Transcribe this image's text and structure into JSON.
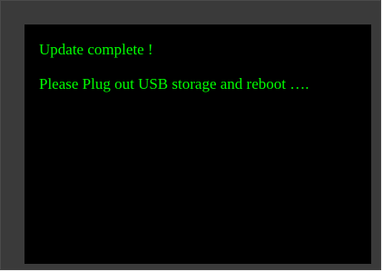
{
  "theme": {
    "text_color": "#00ff00",
    "screen_background": "#000000",
    "bezel_color": "#3a3a3a"
  },
  "screen": {
    "lines": [
      "Update complete !",
      "Please Plug out USB storage and reboot …."
    ]
  }
}
